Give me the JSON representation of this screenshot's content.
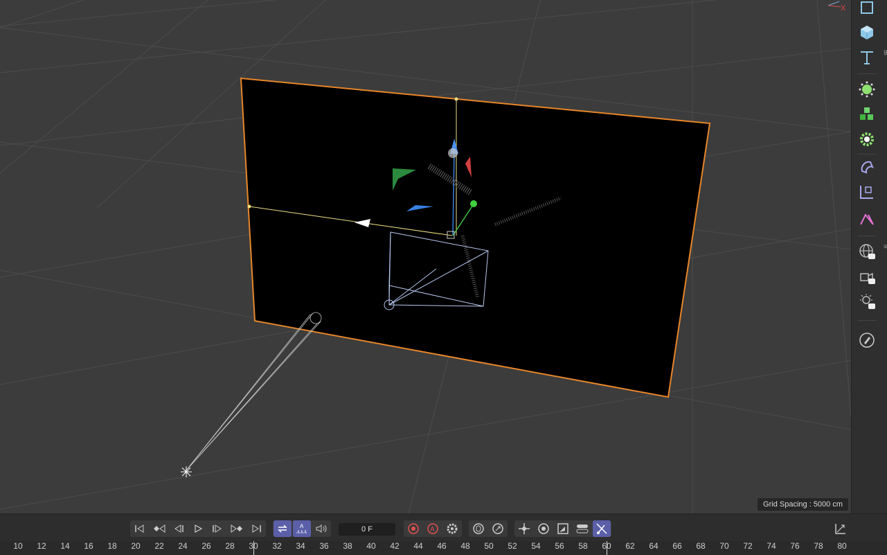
{
  "viewport": {
    "grid_spacing_label": "Grid Spacing : 5000 cm",
    "axis_label": "X"
  },
  "right_toolbar": {
    "items": [
      {
        "name": "rectangle-tool",
        "icon": "square-outline-icon"
      },
      {
        "name": "cube-object",
        "icon": "cube-icon"
      },
      {
        "name": "text-object",
        "icon": "text-T-icon"
      },
      {
        "name": "null-points",
        "icon": "points-icon"
      },
      {
        "name": "cloner",
        "icon": "cloner-cubes-icon"
      },
      {
        "name": "effector",
        "icon": "gear-icon"
      },
      {
        "name": "deformer",
        "icon": "bend-icon"
      },
      {
        "name": "camera",
        "icon": "camera-object-icon"
      },
      {
        "name": "spline-tool",
        "icon": "spline-icon"
      },
      {
        "name": "scene-st",
        "icon": "globe-icon",
        "badge": "ST"
      },
      {
        "name": "camera-st",
        "icon": "camera-rig-icon",
        "badge": "ST"
      },
      {
        "name": "light-st",
        "icon": "light-icon",
        "badge": "ST"
      },
      {
        "name": "edit-tool",
        "icon": "pencil-icon"
      }
    ]
  },
  "transport": {
    "frame_value": "0 F",
    "buttons": [
      "go-to-start",
      "previous-key",
      "previous-frame",
      "play",
      "next-frame",
      "next-key",
      "go-to-end",
      "loop",
      "audio-scrub",
      "sound",
      "record",
      "auto-key",
      "key-settings",
      "key-position",
      "key-rotation",
      "key-scale",
      "key-param",
      "key-pla",
      "key-point-level",
      "graph"
    ]
  },
  "ruler": {
    "labels": [
      "10",
      "12",
      "14",
      "16",
      "18",
      "20",
      "22",
      "24",
      "26",
      "28",
      "30",
      "32",
      "34",
      "36",
      "38",
      "40",
      "42",
      "44",
      "46",
      "48",
      "50",
      "52",
      "54",
      "56",
      "58",
      "60",
      "62",
      "64",
      "66",
      "68",
      "70",
      "72",
      "74",
      "76",
      "78",
      "80"
    ],
    "current_frame": "30"
  },
  "colors": {
    "viewport_bg": "#3c3c3c",
    "selection_outline": "#e8862a",
    "accent": "#5a5fa8",
    "icon_blue": "#8ec7e8"
  }
}
